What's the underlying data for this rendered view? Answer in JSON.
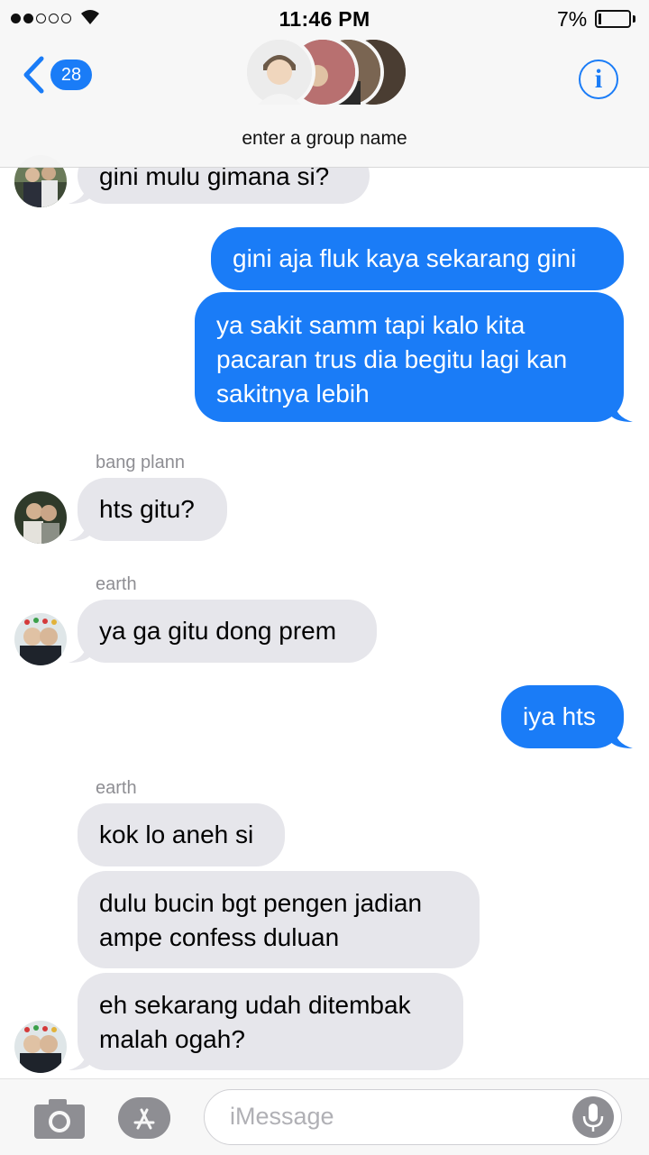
{
  "status_bar": {
    "time": "11:46 PM",
    "battery_percent": "7%",
    "signal_bars_filled": 2,
    "signal_bars_total": 5
  },
  "header": {
    "back_count": "28",
    "group_name": "enter a group name",
    "accent_color": "#1a7cf7"
  },
  "messages": [
    {
      "direction": "incoming",
      "text": "gini mulu gimana si?"
    },
    {
      "direction": "outgoing",
      "text": "gini aja fluk kaya sekarang gini"
    },
    {
      "direction": "outgoing",
      "text": "ya sakit samm tapi kalo kita pacaran trus dia begitu lagi kan sakitnya lebih"
    },
    {
      "direction": "incoming",
      "sender": "bang plann",
      "text": "hts gitu?"
    },
    {
      "direction": "incoming",
      "sender": "earth",
      "text": "ya ga gitu dong prem"
    },
    {
      "direction": "outgoing",
      "text": "iya hts"
    },
    {
      "direction": "incoming",
      "sender": "earth",
      "text": "kok lo aneh si"
    },
    {
      "direction": "incoming",
      "text": "dulu bucin bgt pengen jadian ampe confess duluan"
    },
    {
      "direction": "incoming",
      "text": "eh sekarang udah ditembak malah ogah?"
    }
  ],
  "input_bar": {
    "placeholder": "iMessage",
    "camera_icon": "camera-icon",
    "apps_icon": "app-store-icon",
    "mic_icon": "microphone-icon"
  },
  "colors": {
    "outgoing_bubble": "#1a7cf7",
    "incoming_bubble": "#e6e6eb",
    "sender_label": "#8e8e93"
  }
}
